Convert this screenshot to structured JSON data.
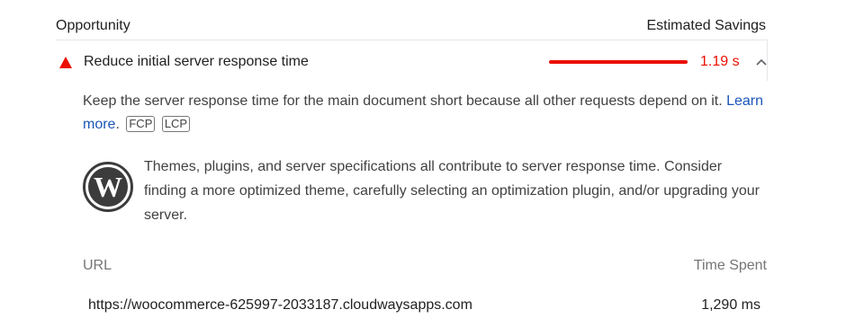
{
  "header": {
    "opportunity_label": "Opportunity",
    "savings_label": "Estimated Savings"
  },
  "audit": {
    "status_icon": "fail-triangle-icon",
    "status_color": "#eb0f00",
    "title": "Reduce initial server response time",
    "savings_value": "1.19 s",
    "expanded": true,
    "description_text": "Keep the server response time for the main document short because all other requests depend on it. ",
    "learn_more": "Learn more",
    "learn_more_suffix": ".",
    "metric_tags": [
      "FCP",
      "LCP"
    ]
  },
  "stack_pack": {
    "icon": "wordpress-logo-icon",
    "text": "Themes, plugins, and server specifications all contribute to server response time. Consider finding a more optimized theme, carefully selecting an optimization plugin, and/or upgrading your server."
  },
  "table": {
    "columns": [
      "URL",
      "Time Spent"
    ],
    "rows": [
      {
        "url": "https://woocommerce-625997-2033187.cloudwaysapps.com",
        "time_spent": "1,290 ms"
      }
    ]
  }
}
